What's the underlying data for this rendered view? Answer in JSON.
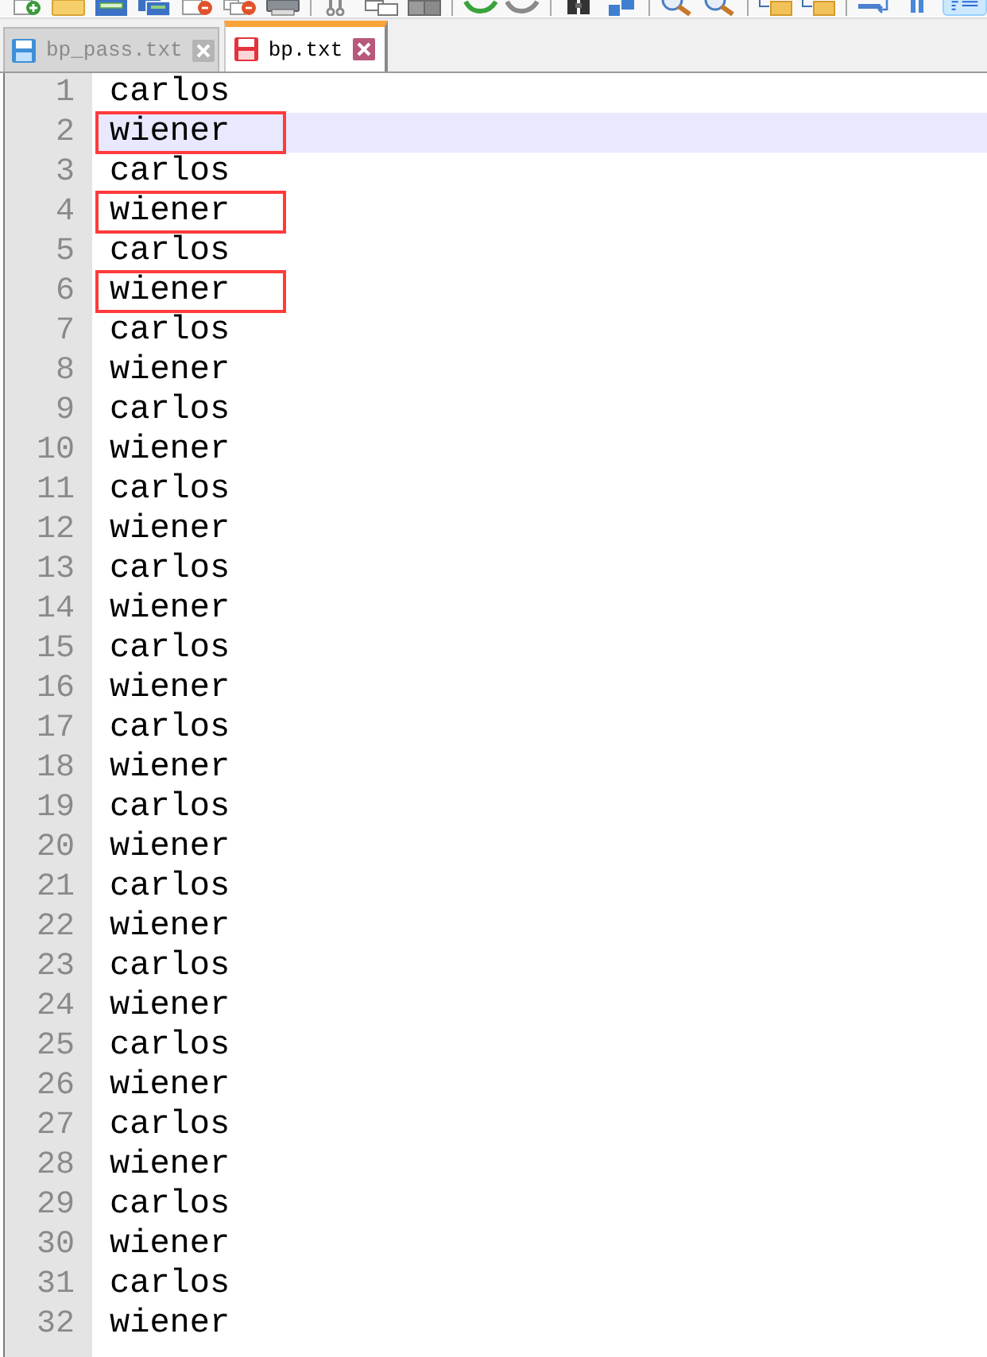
{
  "toolbar": {
    "groups": [
      [
        {
          "kind": "new",
          "pressed": false
        },
        {
          "kind": "open",
          "pressed": false
        },
        {
          "kind": "save",
          "pressed": false
        },
        {
          "kind": "saveall",
          "pressed": false
        },
        {
          "kind": "close",
          "pressed": false
        },
        {
          "kind": "closeall",
          "pressed": false
        },
        {
          "kind": "print",
          "pressed": false
        }
      ],
      [
        {
          "kind": "cut",
          "pressed": false
        },
        {
          "kind": "copy",
          "pressed": false
        },
        {
          "kind": "paste",
          "pressed": false
        }
      ],
      [
        {
          "kind": "undo",
          "pressed": false
        },
        {
          "kind": "redo",
          "pressed": false
        }
      ],
      [
        {
          "kind": "find",
          "pressed": false
        },
        {
          "kind": "replace",
          "pressed": false
        }
      ],
      [
        {
          "kind": "zoomin",
          "pressed": false
        },
        {
          "kind": "zoomout",
          "pressed": false
        }
      ],
      [
        {
          "kind": "syncv",
          "pressed": false
        },
        {
          "kind": "synch",
          "pressed": false
        }
      ],
      [
        {
          "kind": "wrap",
          "pressed": false
        },
        {
          "kind": "columns",
          "pressed": false
        },
        {
          "kind": "guides",
          "pressed": true
        }
      ]
    ]
  },
  "tabs": [
    {
      "label": "bp_pass.txt",
      "selected": false,
      "modified": false
    },
    {
      "label": "bp.txt",
      "selected": true,
      "modified": true
    }
  ],
  "editor": {
    "lines": [
      {
        "number": "1",
        "text": "carlos",
        "current": false,
        "boxed": false
      },
      {
        "number": "2",
        "text": "wiener",
        "current": true,
        "boxed": true
      },
      {
        "number": "3",
        "text": "carlos",
        "current": false,
        "boxed": false
      },
      {
        "number": "4",
        "text": "wiener",
        "current": false,
        "boxed": true
      },
      {
        "number": "5",
        "text": "carlos",
        "current": false,
        "boxed": false
      },
      {
        "number": "6",
        "text": "wiener",
        "current": false,
        "boxed": true
      },
      {
        "number": "7",
        "text": "carlos",
        "current": false,
        "boxed": false
      },
      {
        "number": "8",
        "text": "wiener",
        "current": false,
        "boxed": false
      },
      {
        "number": "9",
        "text": "carlos",
        "current": false,
        "boxed": false
      },
      {
        "number": "10",
        "text": "wiener",
        "current": false,
        "boxed": false
      },
      {
        "number": "11",
        "text": "carlos",
        "current": false,
        "boxed": false
      },
      {
        "number": "12",
        "text": "wiener",
        "current": false,
        "boxed": false
      },
      {
        "number": "13",
        "text": "carlos",
        "current": false,
        "boxed": false
      },
      {
        "number": "14",
        "text": "wiener",
        "current": false,
        "boxed": false
      },
      {
        "number": "15",
        "text": "carlos",
        "current": false,
        "boxed": false
      },
      {
        "number": "16",
        "text": "wiener",
        "current": false,
        "boxed": false
      },
      {
        "number": "17",
        "text": "carlos",
        "current": false,
        "boxed": false
      },
      {
        "number": "18",
        "text": "wiener",
        "current": false,
        "boxed": false
      },
      {
        "number": "19",
        "text": "carlos",
        "current": false,
        "boxed": false
      },
      {
        "number": "20",
        "text": "wiener",
        "current": false,
        "boxed": false
      },
      {
        "number": "21",
        "text": "carlos",
        "current": false,
        "boxed": false
      },
      {
        "number": "22",
        "text": "wiener",
        "current": false,
        "boxed": false
      },
      {
        "number": "23",
        "text": "carlos",
        "current": false,
        "boxed": false
      },
      {
        "number": "24",
        "text": "wiener",
        "current": false,
        "boxed": false
      },
      {
        "number": "25",
        "text": "carlos",
        "current": false,
        "boxed": false
      },
      {
        "number": "26",
        "text": "wiener",
        "current": false,
        "boxed": false
      },
      {
        "number": "27",
        "text": "carlos",
        "current": false,
        "boxed": false
      },
      {
        "number": "28",
        "text": "wiener",
        "current": false,
        "boxed": false
      },
      {
        "number": "29",
        "text": "carlos",
        "current": false,
        "boxed": false
      },
      {
        "number": "30",
        "text": "wiener",
        "current": false,
        "boxed": false
      },
      {
        "number": "31",
        "text": "carlos",
        "current": false,
        "boxed": false
      },
      {
        "number": "32",
        "text": "wiener",
        "current": false,
        "boxed": false
      }
    ]
  }
}
